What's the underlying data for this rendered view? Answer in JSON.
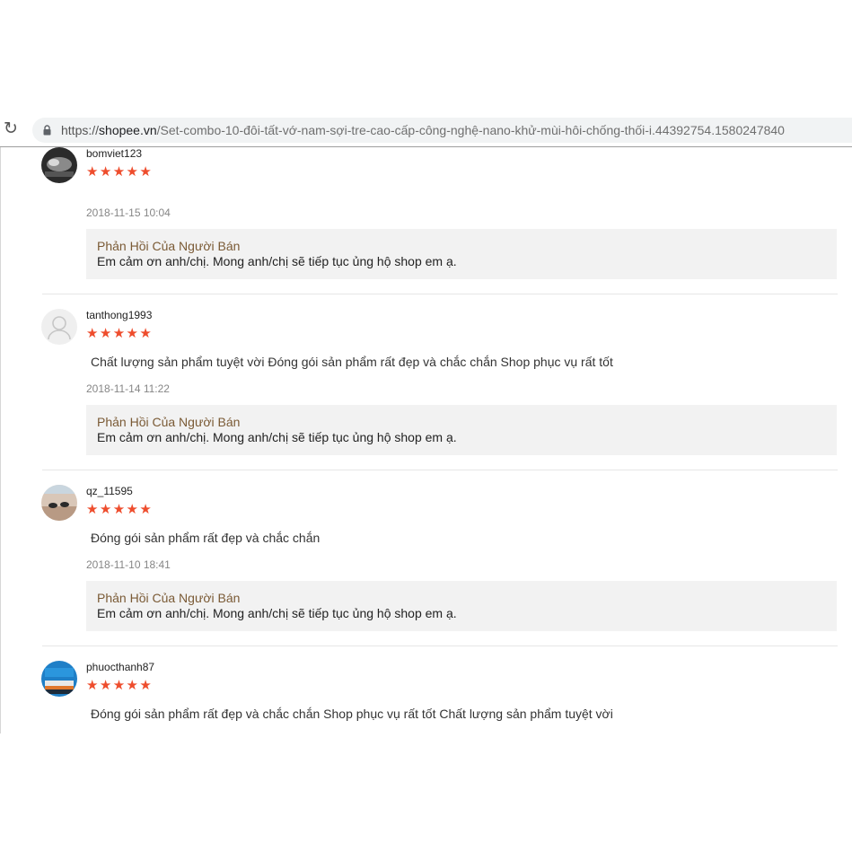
{
  "browser": {
    "url_protocol": "https://",
    "url_host": "shopee.vn",
    "url_path": "/Set-combo-10-đôi-tất-vớ-nam-sợi-tre-cao-cấp-công-nghệ-nano-khử-mùi-hôi-chống-thối-i.44392754.1580247840"
  },
  "reviews": [
    {
      "username": "bomviet123",
      "stars": "★★★★★",
      "rating": 5,
      "comment": "",
      "time": "2018-11-15 10:04",
      "reply_title": "Phản Hồi Của Người Bán",
      "reply_text": "Em cảm ơn anh/chị. Mong anh/chị sẽ tiếp tục ủng hộ shop em ạ."
    },
    {
      "username": "tanthong1993",
      "stars": "★★★★★",
      "rating": 5,
      "comment": "Chất lượng sản phẩm tuyệt vời Đóng gói sản phẩm rất đẹp và chắc chắn Shop phục vụ rất tốt",
      "time": "2018-11-14 11:22",
      "reply_title": "Phản Hồi Của Người Bán",
      "reply_text": "Em cảm ơn anh/chị. Mong anh/chị sẽ tiếp tục ủng hộ shop em ạ."
    },
    {
      "username": "qz_11595",
      "stars": "★★★★★",
      "rating": 5,
      "comment": "Đóng gói sản phẩm rất đẹp và chắc chắn",
      "time": "2018-11-10 18:41",
      "reply_title": "Phản Hồi Của Người Bán",
      "reply_text": "Em cảm ơn anh/chị. Mong anh/chị sẽ tiếp tục ủng hộ shop em ạ."
    },
    {
      "username": "phuocthanh87",
      "stars": "★★★★★",
      "rating": 5,
      "comment": "Đóng gói sản phẩm rất đẹp và chắc chắn Shop phục vụ rất tốt Chất lượng sản phẩm tuyệt vời"
    }
  ],
  "colors": {
    "star": "#ee4d2d",
    "reply_title": "#7a5a35",
    "reply_bg": "#f2f2f2"
  }
}
